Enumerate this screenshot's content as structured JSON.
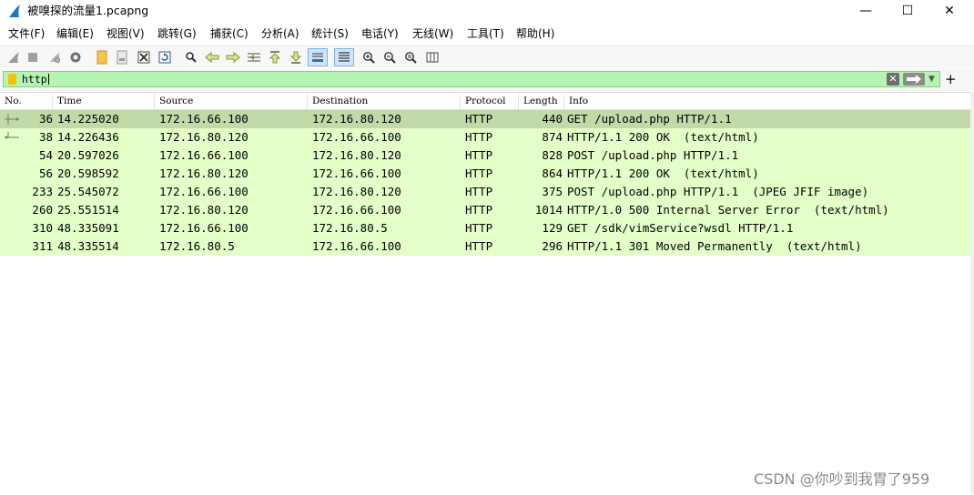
{
  "window": {
    "title": "被嗅探的流量1.pcapng",
    "minimize_glyph": "—",
    "maximize_glyph": "☐",
    "close_glyph": "✕"
  },
  "menu": [
    "文件(F)",
    "编辑(E)",
    "视图(V)",
    "跳转(G)",
    "捕获(C)",
    "分析(A)",
    "统计(S)",
    "电话(Y)",
    "无线(W)",
    "工具(T)",
    "帮助(H)"
  ],
  "toolbar": {
    "icons": [
      "shark-start-icon",
      "stop-icon",
      "restart-icon",
      "options-gear-icon",
      "open-file-icon",
      "save-file-icon",
      "close-file-icon",
      "reload-icon",
      "find-icon",
      "back-arrow-icon",
      "forward-arrow-icon",
      "go-to-packet-icon",
      "first-packet-icon",
      "last-packet-icon",
      "autoscroll-icon",
      "colorize-icon",
      "zoom-in-icon",
      "zoom-out-icon",
      "normal-size-icon",
      "resize-columns-icon"
    ]
  },
  "filter": {
    "value": "http",
    "clear_glyph": "✕",
    "apply_glyph": "➡",
    "dropdown_glyph": "▼",
    "add_glyph": "+"
  },
  "columns": [
    "No.",
    "Time",
    "Source",
    "Destination",
    "Protocol",
    "Length",
    "Info"
  ],
  "packets": [
    {
      "no": "36",
      "time": "14.225020",
      "src": "172.16.66.100",
      "dst": "172.16.80.120",
      "proto": "HTTP",
      "len": "440",
      "info": "GET /upload.php HTTP/1.1",
      "selected": true,
      "rel": "request"
    },
    {
      "no": "38",
      "time": "14.226436",
      "src": "172.16.80.120",
      "dst": "172.16.66.100",
      "proto": "HTTP",
      "len": "874",
      "info": "HTTP/1.1 200 OK  (text/html)",
      "selected": false,
      "rel": "response"
    },
    {
      "no": "54",
      "time": "20.597026",
      "src": "172.16.66.100",
      "dst": "172.16.80.120",
      "proto": "HTTP",
      "len": "828",
      "info": "POST /upload.php HTTP/1.1",
      "selected": false,
      "rel": ""
    },
    {
      "no": "56",
      "time": "20.598592",
      "src": "172.16.80.120",
      "dst": "172.16.66.100",
      "proto": "HTTP",
      "len": "864",
      "info": "HTTP/1.1 200 OK  (text/html)",
      "selected": false,
      "rel": ""
    },
    {
      "no": "233",
      "time": "25.545072",
      "src": "172.16.66.100",
      "dst": "172.16.80.120",
      "proto": "HTTP",
      "len": "375",
      "info": "POST /upload.php HTTP/1.1  (JPEG JFIF image)",
      "selected": false,
      "rel": ""
    },
    {
      "no": "260",
      "time": "25.551514",
      "src": "172.16.80.120",
      "dst": "172.16.66.100",
      "proto": "HTTP",
      "len": "1014",
      "info": "HTTP/1.0 500 Internal Server Error  (text/html)",
      "selected": false,
      "rel": ""
    },
    {
      "no": "310",
      "time": "48.335091",
      "src": "172.16.66.100",
      "dst": "172.16.80.5",
      "proto": "HTTP",
      "len": "129",
      "info": "GET /sdk/vimService?wsdl HTTP/1.1",
      "selected": false,
      "rel": ""
    },
    {
      "no": "311",
      "time": "48.335514",
      "src": "172.16.80.5",
      "dst": "172.16.66.100",
      "proto": "HTTP",
      "len": "296",
      "info": "HTTP/1.1 301 Moved Permanently  (text/html)",
      "selected": false,
      "rel": ""
    }
  ],
  "watermark": "CSDN @你吵到我胃了959"
}
